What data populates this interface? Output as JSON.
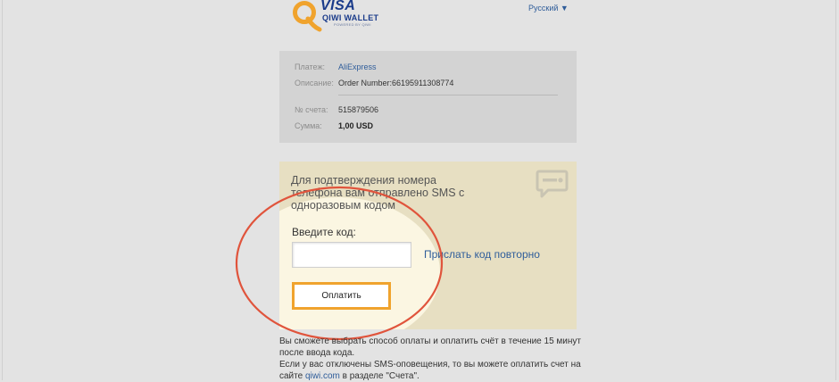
{
  "header": {
    "logo_visa": "VISA",
    "logo_wallet": "QIWI WALLET",
    "logo_powered": "POWERED BY QIWI",
    "language": "Русский ▼"
  },
  "payment": {
    "rows": [
      {
        "label": "Платеж:",
        "value": "AliExpress"
      },
      {
        "label": "Описание:",
        "value": "Order Number:66195911308774"
      },
      {
        "label": "№ счета:",
        "value": "515879506"
      },
      {
        "label": "Сумма:",
        "value": "1,00 USD"
      }
    ]
  },
  "sms": {
    "message": "Для подтверждения номера телефона вам отправлено SMS с одноразовым кодом",
    "code_label": "Введите код:",
    "code_value": "",
    "resend_label": "Прислать код повторно",
    "pay_label": "Оплатить"
  },
  "footer": {
    "line1": "Вы сможете выбрать способ оплаты и оплатить счёт в течение 15 минут после ввода кода.",
    "line2_prefix": "Если у вас отключены SMS-оповещения, то вы можете оплатить счет на сайте ",
    "line2_link": "qiwi.com",
    "line2_suffix": " в разделе \"Счета\"."
  },
  "colors": {
    "accent_orange": "#f0a32d",
    "link_blue": "#2f5d9a",
    "annotation_red": "#e0543c",
    "sms_box_bg": "#e7dfc2"
  }
}
